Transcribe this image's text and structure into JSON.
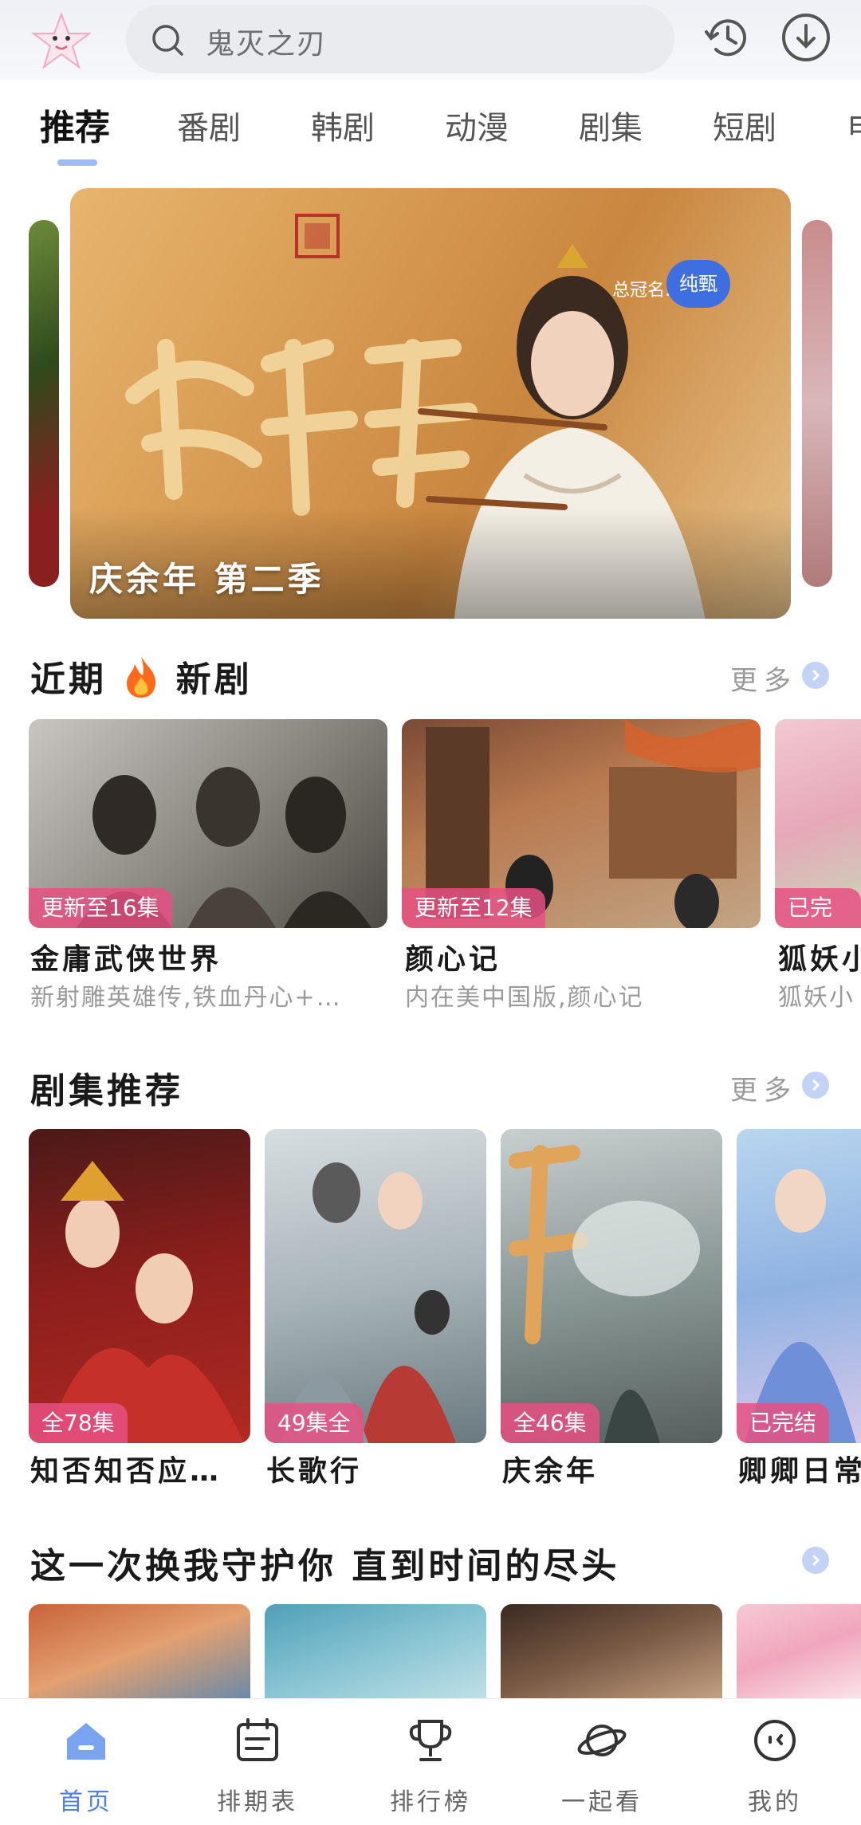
{
  "search": {
    "placeholder": "鬼灭之刃"
  },
  "tabs": [
    "推荐",
    "番剧",
    "韩剧",
    "动漫",
    "剧集",
    "短剧",
    "电"
  ],
  "banner": {
    "title": "庆余年 第二季",
    "sponsor_label": "总冠名:",
    "sponsor_brand": "纯甄"
  },
  "recent": {
    "title_part1": "近期",
    "title_part2": "新剧",
    "more": "更多",
    "items": [
      {
        "badge": "更新至16集",
        "name": "金庸武侠世界",
        "sub": "新射雕英雄传,铁血丹心+…"
      },
      {
        "badge": "更新至12集",
        "name": "颜心记",
        "sub": "内在美中国版,颜心记"
      },
      {
        "badge": "已完结",
        "name": "狐妖小",
        "sub": "狐妖小"
      }
    ]
  },
  "series": {
    "title": "剧集推荐",
    "more": "更多",
    "items": [
      {
        "badge": "全78集",
        "name": "知否知否应…"
      },
      {
        "badge": "49集全",
        "name": "长歌行"
      },
      {
        "badge": "全46集",
        "name": "庆余年"
      },
      {
        "badge": "已完结",
        "name": "卿卿日常"
      }
    ]
  },
  "guard": {
    "title": "这一次换我守护你 直到时间的尽头"
  },
  "nav": [
    {
      "label": "首页",
      "icon": "home-icon"
    },
    {
      "label": "排期表",
      "icon": "schedule-icon"
    },
    {
      "label": "排行榜",
      "icon": "trophy-icon"
    },
    {
      "label": "一起看",
      "icon": "planet-icon"
    },
    {
      "label": "我的",
      "icon": "profile-icon"
    }
  ],
  "colors": {
    "accent": "#4e7fe6",
    "badge": "#e65082",
    "more_dot": "#c3d3f5"
  }
}
